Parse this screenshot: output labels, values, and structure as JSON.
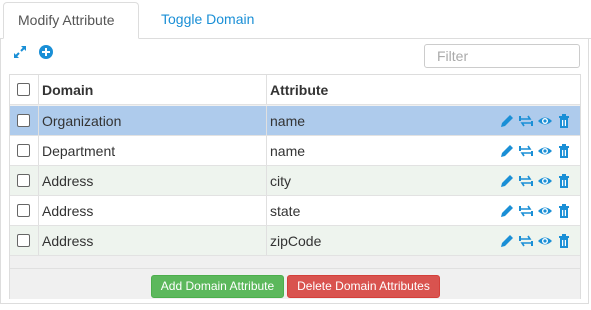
{
  "tabs": [
    {
      "label": "Modify Attribute",
      "active": true
    },
    {
      "label": "Toggle Domain",
      "active": false
    }
  ],
  "toolbar": {
    "expand_icon": "expand-icon",
    "add_icon": "plus-circle-icon",
    "filter_placeholder": "Filter"
  },
  "table": {
    "headers": {
      "domain": "Domain",
      "attribute": "Attribute"
    },
    "rows": [
      {
        "domain": "Organization",
        "attribute": "name",
        "selected": true
      },
      {
        "domain": "Department",
        "attribute": "name",
        "selected": false
      },
      {
        "domain": "Address",
        "attribute": "city",
        "selected": false
      },
      {
        "domain": "Address",
        "attribute": "state",
        "selected": false
      },
      {
        "domain": "Address",
        "attribute": "zipCode",
        "selected": false
      }
    ],
    "row_actions": [
      "pencil-icon",
      "swap-icon",
      "eye-icon",
      "trash-icon"
    ]
  },
  "buttons": {
    "add": "Add Domain Attribute",
    "delete": "Delete Domain Attributes"
  },
  "colors": {
    "link_blue": "#1a8fd6",
    "selected_row": "#aecbec",
    "alt_row": "#eef4ee",
    "add_green": "#5cb85c",
    "delete_red": "#d9534f"
  }
}
